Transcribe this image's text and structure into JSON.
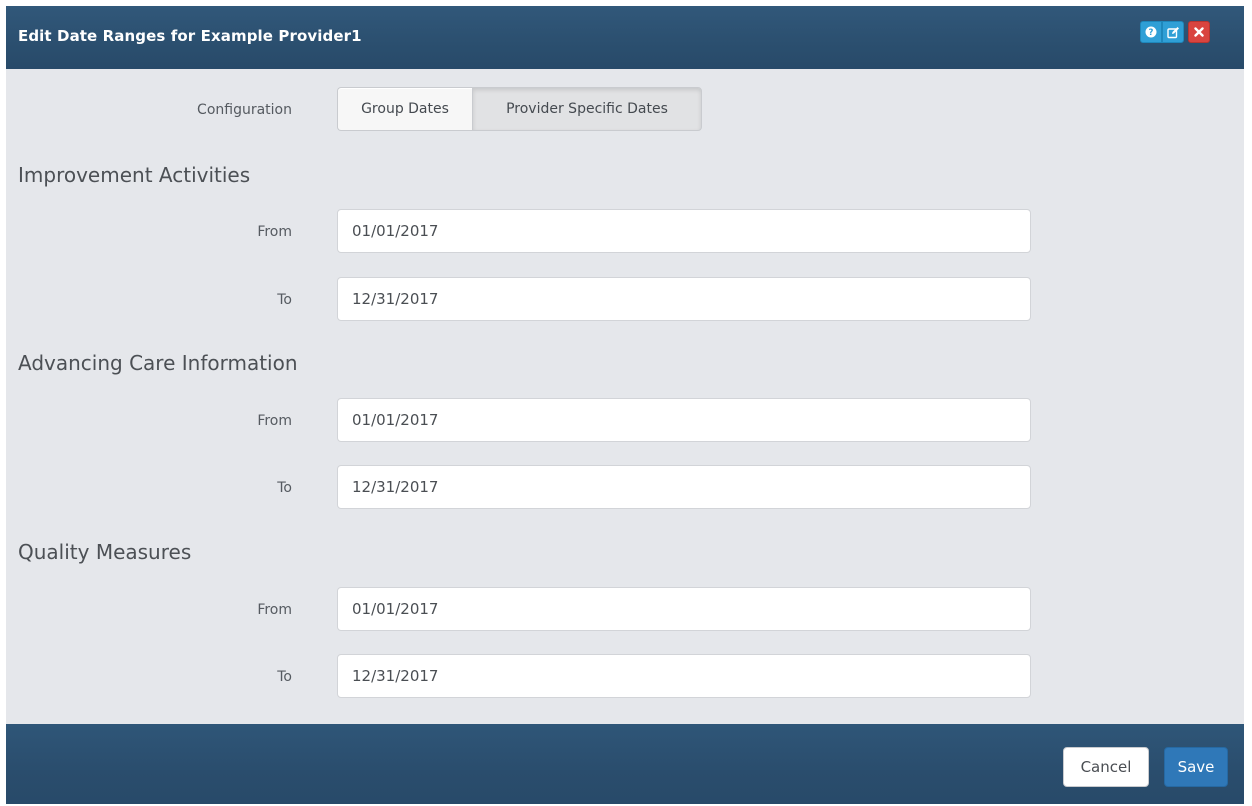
{
  "dialog": {
    "title": "Edit Date Ranges for Example Provider1",
    "header_icons": [
      "help-icon",
      "edit-icon",
      "close-icon"
    ]
  },
  "configuration": {
    "label": "Configuration",
    "options": [
      {
        "label": "Group Dates",
        "selected": false
      },
      {
        "label": "Provider Specific Dates",
        "selected": true
      }
    ]
  },
  "sections": [
    {
      "title": "Improvement Activities",
      "from_label": "From",
      "from_value": "01/01/2017",
      "to_label": "To",
      "to_value": "12/31/2017"
    },
    {
      "title": "Advancing Care Information",
      "from_label": "From",
      "from_value": "01/01/2017",
      "to_label": "To",
      "to_value": "12/31/2017"
    },
    {
      "title": "Quality Measures",
      "from_label": "From",
      "from_value": "01/01/2017",
      "to_label": "To",
      "to_value": "12/31/2017"
    }
  ],
  "footer": {
    "cancel_label": "Cancel",
    "save_label": "Save"
  },
  "colors": {
    "header": "#2b4f6f",
    "body": "#e5e7eb",
    "primary_button": "#2f78b8",
    "info_button": "#2f9fd6",
    "danger_button": "#d9443f"
  }
}
